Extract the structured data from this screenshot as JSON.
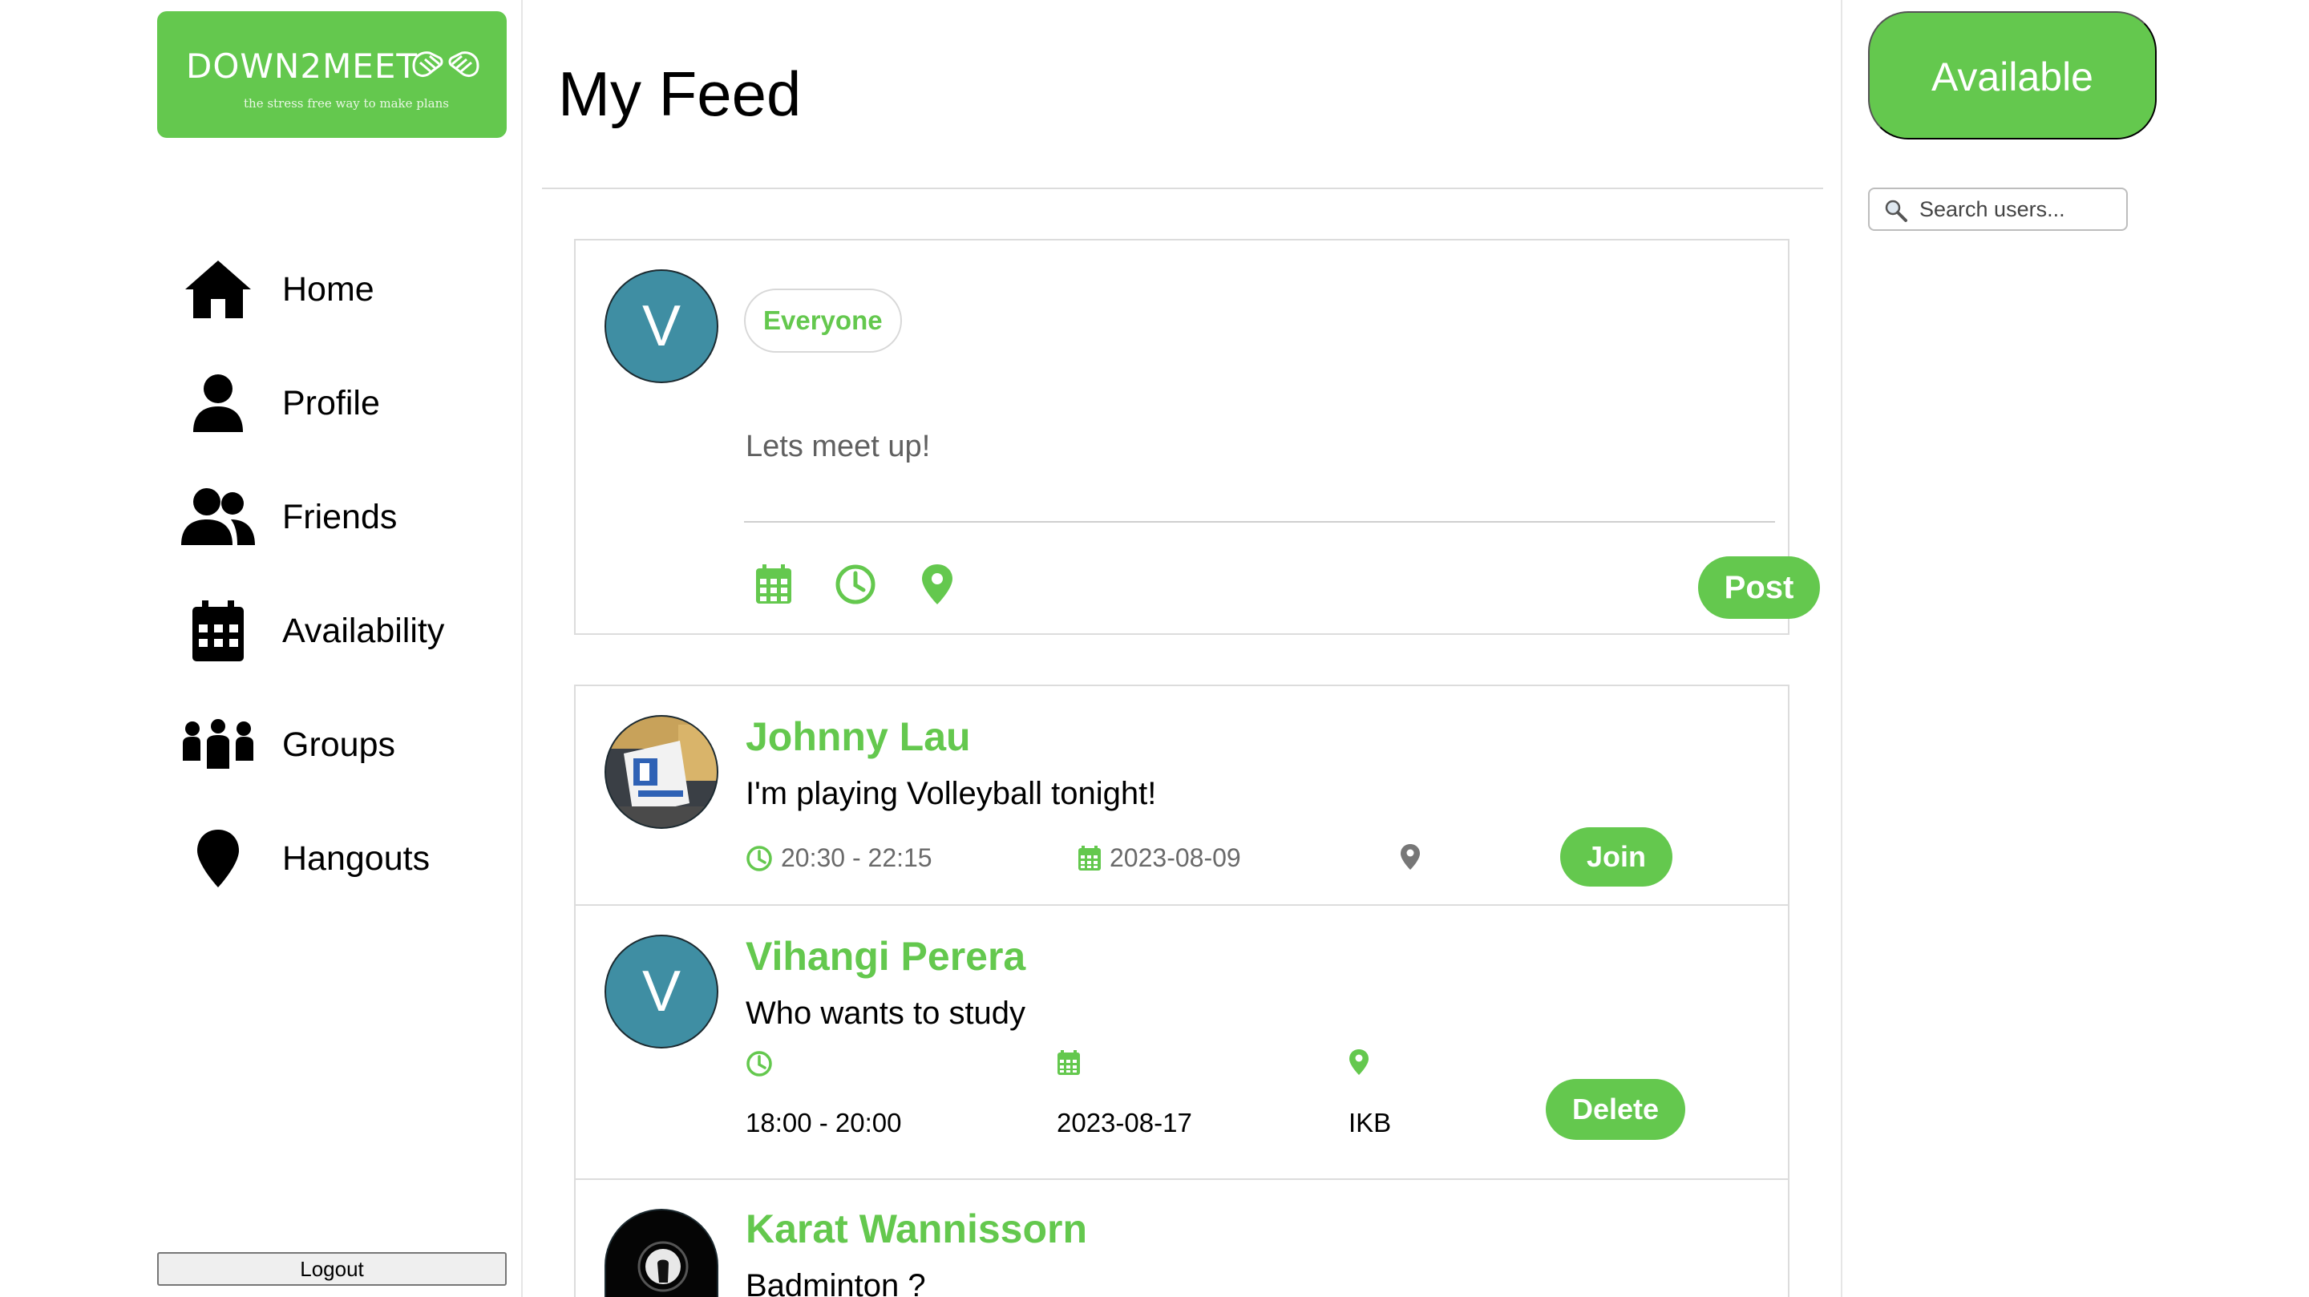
{
  "brand": {
    "name": "DOWN2MEET",
    "tagline": "the stress free way to make plans"
  },
  "nav": [
    {
      "label": "Home",
      "icon": "home-icon"
    },
    {
      "label": "Profile",
      "icon": "user-icon"
    },
    {
      "label": "Friends",
      "icon": "friends-icon"
    },
    {
      "label": "Availability",
      "icon": "calendar-icon"
    },
    {
      "label": "Groups",
      "icon": "groups-icon"
    },
    {
      "label": "Hangouts",
      "icon": "location-pin-icon"
    }
  ],
  "logout_label": "Logout",
  "feed": {
    "title": "My Feed",
    "composer": {
      "avatar_letter": "V",
      "audience": "Everyone",
      "placeholder": "Lets meet up!",
      "post_label": "Post"
    },
    "posts": [
      {
        "author": "Johnny Lau",
        "text": "I'm playing Volleyball tonight!",
        "time": "20:30 - 22:15",
        "date": "2023-08-09",
        "location": "",
        "action": "Join"
      },
      {
        "author": "Vihangi Perera",
        "avatar_letter": "V",
        "text": "Who wants to study",
        "time": "18:00 - 20:00",
        "date": "2023-08-17",
        "location": "IKB",
        "action": "Delete"
      },
      {
        "author": "Karat Wannissorn",
        "text": "Badminton ?"
      }
    ]
  },
  "status": {
    "available_label": "Available"
  },
  "search": {
    "placeholder": "Search users..."
  },
  "colors": {
    "accent": "#64c84e",
    "avatar_bg": "#3f8ea3"
  }
}
